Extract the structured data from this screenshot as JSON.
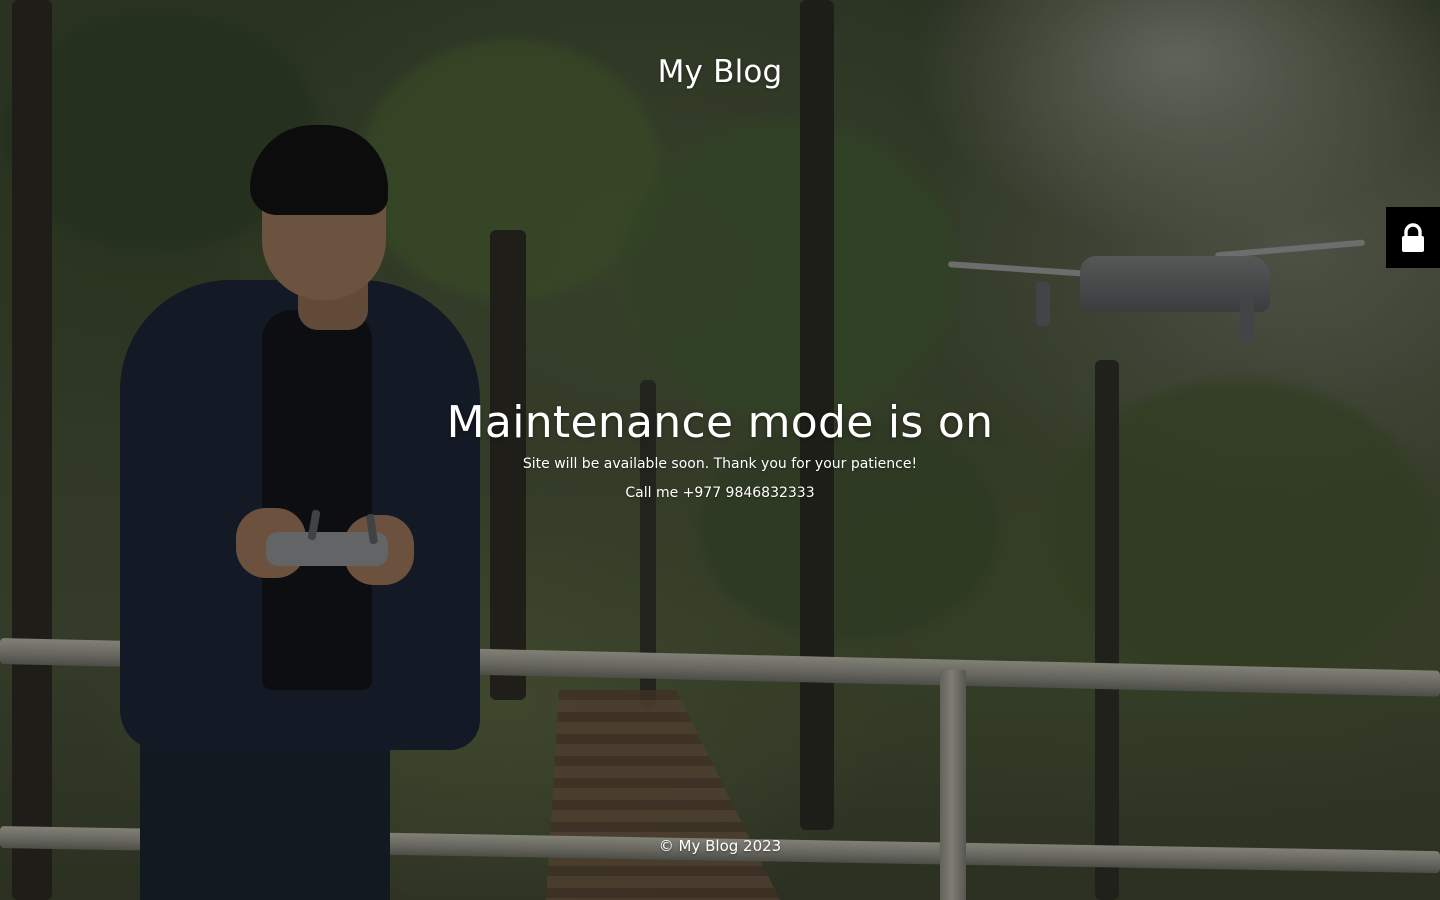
{
  "site": {
    "title": "My Blog"
  },
  "maintenance": {
    "headline": "Maintenance mode is on",
    "message": "Site will be available soon. Thank you for your patience!",
    "contact": "Call me +977 9846832333"
  },
  "footer": {
    "copyright": "© My Blog 2023"
  },
  "login": {
    "icon": "lock-icon",
    "background_color": "#000000",
    "icon_color": "#ffffff"
  },
  "background": {
    "description_icon": "hero-photo"
  }
}
